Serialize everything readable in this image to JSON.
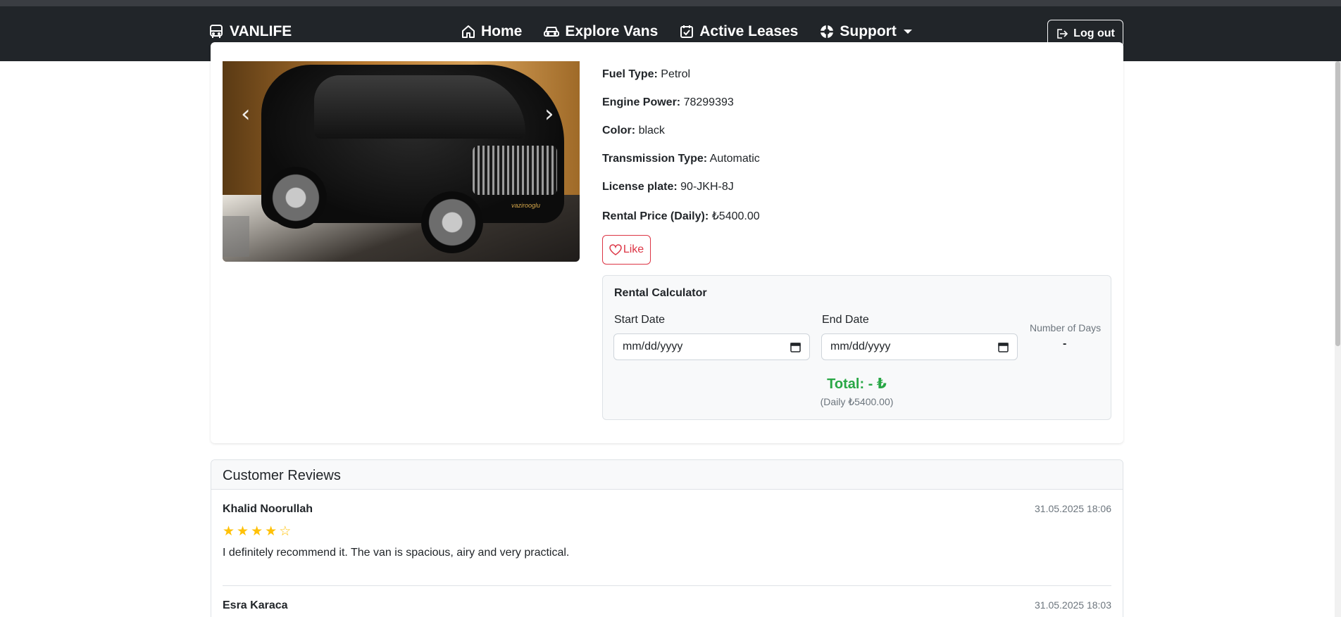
{
  "brand": {
    "name": "VANLIFE"
  },
  "nav": [
    {
      "label": "Home"
    },
    {
      "label": "Explore Vans"
    },
    {
      "label": "Active Leases"
    },
    {
      "label": "Support"
    }
  ],
  "logout_label": "Log out",
  "carousel": {
    "plate_text": "vazirooglu"
  },
  "specs": [
    {
      "label": "Fuel Type:",
      "value": "Petrol"
    },
    {
      "label": "Engine Power:",
      "value": "78299393"
    },
    {
      "label": "Color:",
      "value": "black"
    },
    {
      "label": "Transmission Type:",
      "value": "Automatic"
    },
    {
      "label": "License plate:",
      "value": "90-JKH-8J"
    },
    {
      "label": "Rental Price (Daily):",
      "value": "₺5400.00"
    }
  ],
  "like_label": "Like",
  "calculator": {
    "title": "Rental Calculator",
    "start_label": "Start Date",
    "end_label": "End Date",
    "start_placeholder": "mm/dd/yyyy",
    "end_placeholder": "mm/dd/yyyy",
    "days_label": "Number of Days",
    "days_value": "-",
    "total": "Total: - ₺",
    "daily_note": "(Daily ₺5400.00)"
  },
  "reviews": {
    "title": "Customer Reviews",
    "items": [
      {
        "name": "Khalid Noorullah",
        "date": "31.05.2025 18:06",
        "rating": 4,
        "text": "I definitely recommend it. The van is spacious, airy and very practical."
      },
      {
        "name": "Esra Karaca",
        "date": "31.05.2025 18:03",
        "rating": null,
        "text": ""
      }
    ]
  },
  "colors": {
    "navbar": "#212529",
    "like": "#dc3545",
    "total": "#28a745",
    "star": "#ffc107"
  }
}
